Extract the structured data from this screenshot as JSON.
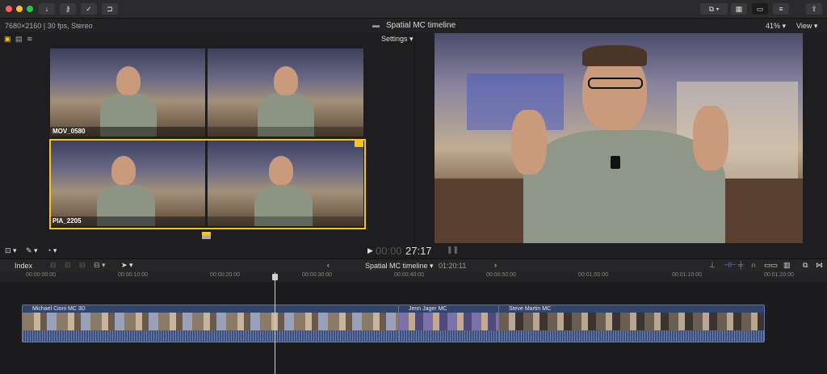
{
  "toolbar": {
    "left_icons": [
      "download-icon",
      "key-icon",
      "checkmark-icon",
      "tag-icon"
    ],
    "right_icons": [
      "share-icon"
    ]
  },
  "infobar": {
    "format": "7680×2160 | 30 fps, Stereo",
    "title": "Spatial MC timeline",
    "zoom": "41%",
    "view_label": "View"
  },
  "browser": {
    "settings_label": "Settings",
    "angles": [
      {
        "label": "MOV_0580"
      },
      {
        "label": "PIA_2205"
      }
    ]
  },
  "transport": {
    "timecode_dim": "00:00",
    "timecode": "27:17"
  },
  "timeline": {
    "index_label": "Index",
    "title": "Spatial MC timeline",
    "duration": "01:20:11",
    "ruler": [
      "00:00:00:00",
      "00:00:10:00",
      "00:00:20:00",
      "00:00:30:00",
      "00:00:40:00",
      "00:00:50:00",
      "00:01:00:00",
      "00:01:10:00",
      "00:01:20:00"
    ],
    "clips": [
      {
        "name": "Michael Cioni MC 3D"
      },
      {
        "name": "Jenn Jager MC"
      },
      {
        "name": "Steve Martin MC"
      }
    ]
  },
  "colors": {
    "accent": "#f5c518",
    "clip": "#3b4f7a"
  }
}
